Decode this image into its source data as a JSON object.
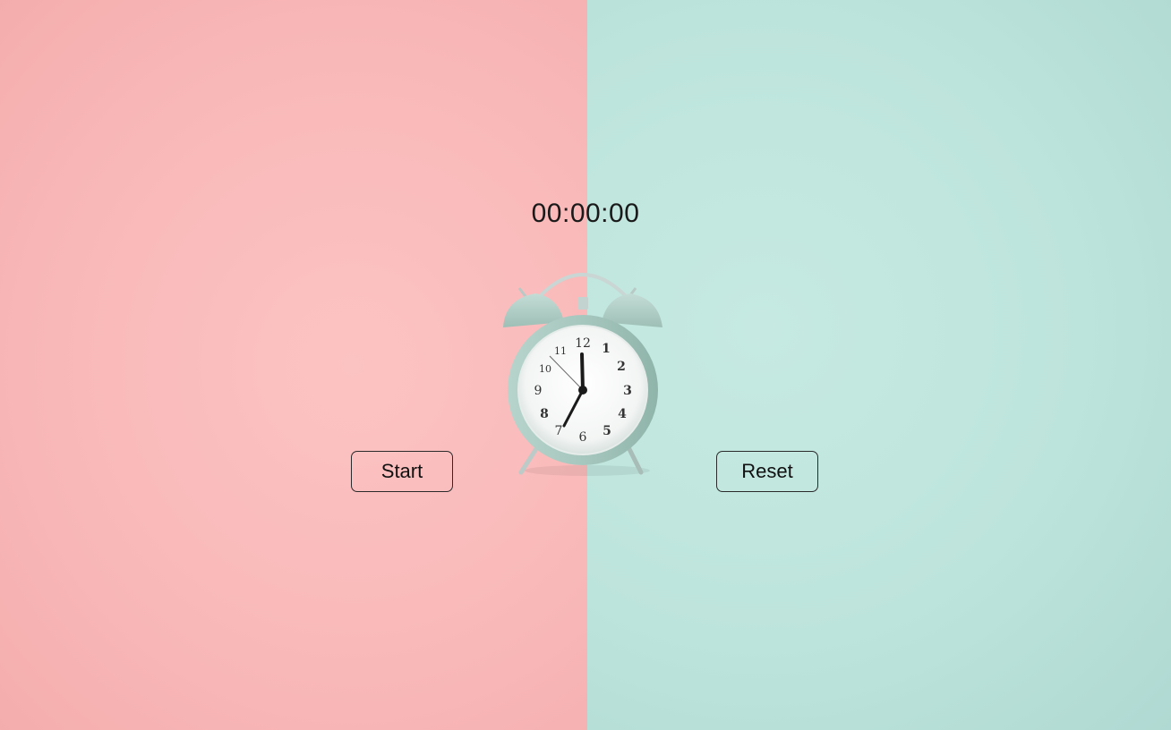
{
  "timer": {
    "display": "00:00:00"
  },
  "controls": {
    "start_label": "Start",
    "reset_label": "Reset"
  },
  "clock_face": {
    "numerals": [
      "12",
      "1",
      "2",
      "3",
      "4",
      "5",
      "6",
      "7",
      "8",
      "9",
      "10",
      "11"
    ]
  },
  "colors": {
    "left_background": "#fbbdbd",
    "right_background": "#bfe5de",
    "clock_body": "#a9cbc2"
  }
}
